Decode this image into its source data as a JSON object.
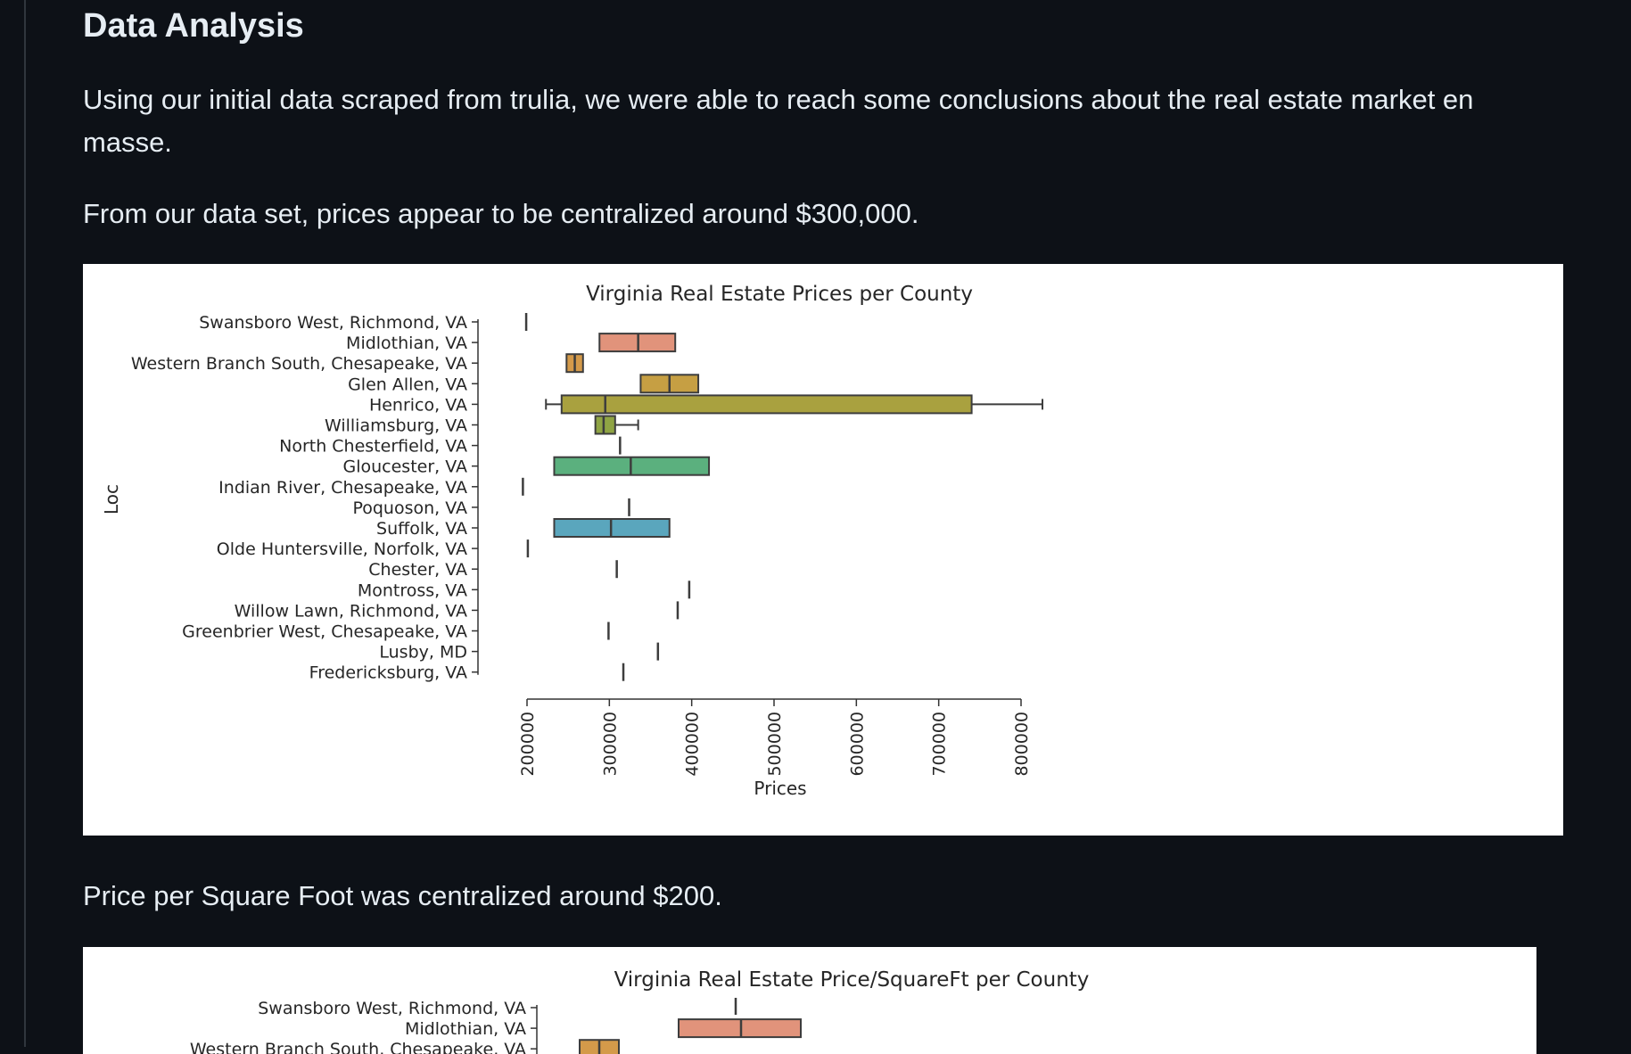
{
  "heading": "Data Analysis",
  "paragraphs": {
    "intro": "Using our initial data scraped from trulia, we were able to reach some conclusions about the real estate market en masse.",
    "prices": "From our data set, prices appear to be centralized around $300,000.",
    "ppsf": "Price per Square Foot was centralized around $200."
  },
  "chart_data": [
    {
      "type": "boxplot",
      "orientation": "horizontal",
      "title": "Virginia Real Estate Prices per County",
      "xlabel": "Prices",
      "ylabel": "Loc",
      "xlim": [
        200000,
        800000
      ],
      "xticks": [
        200000,
        300000,
        400000,
        500000,
        600000,
        700000,
        800000
      ],
      "tick_label_rotation": 90,
      "categories": [
        {
          "label": "Swansboro West, Richmond, VA",
          "color": "#cccccc",
          "whislo": 199000,
          "q1": 199000,
          "med": 199000,
          "q3": 199000,
          "whishi": 199000
        },
        {
          "label": "Midlothian, VA",
          "color": "#e1937b",
          "whislo": 288000,
          "q1": 288000,
          "med": 335000,
          "q3": 380000,
          "whishi": 380000
        },
        {
          "label": "Western Branch South, Chesapeake, VA",
          "color": "#d49a4a",
          "whislo": 248000,
          "q1": 248000,
          "med": 258000,
          "q3": 268000,
          "whishi": 268000
        },
        {
          "label": "Glen Allen, VA",
          "color": "#c69f43",
          "whislo": 338000,
          "q1": 338000,
          "med": 373000,
          "q3": 408000,
          "whishi": 408000
        },
        {
          "label": "Henrico, VA",
          "color": "#a9a13f",
          "whislo": 223000,
          "q1": 242000,
          "med": 295000,
          "q3": 740000,
          "whishi": 826000
        },
        {
          "label": "Williamsburg, VA",
          "color": "#8fa444",
          "whislo": 283000,
          "q1": 283000,
          "med": 293000,
          "q3": 307000,
          "whishi": 335000
        },
        {
          "label": "North Chesterfield, VA",
          "color": "#6aa65a",
          "whislo": 313000,
          "q1": 313000,
          "med": 313000,
          "q3": 313000,
          "whishi": 313000
        },
        {
          "label": "Gloucester, VA",
          "color": "#5bb07e",
          "whislo": 233000,
          "q1": 233000,
          "med": 326000,
          "q3": 421000,
          "whishi": 421000
        },
        {
          "label": "Indian River, Chesapeake, VA",
          "color": "#5aac95",
          "whislo": 195000,
          "q1": 195000,
          "med": 195000,
          "q3": 195000,
          "whishi": 195000
        },
        {
          "label": "Poquoson, VA",
          "color": "#5aa8a6",
          "whislo": 324000,
          "q1": 324000,
          "med": 324000,
          "q3": 324000,
          "whishi": 324000
        },
        {
          "label": "Suffolk, VA",
          "color": "#5aa6bd",
          "whislo": 233000,
          "q1": 233000,
          "med": 302000,
          "q3": 373000,
          "whishi": 373000
        },
        {
          "label": "Olde Huntersville, Norfolk, VA",
          "color": "#6a9fd0",
          "whislo": 201000,
          "q1": 201000,
          "med": 201000,
          "q3": 201000,
          "whishi": 201000
        },
        {
          "label": "Chester, VA",
          "color": "#8f95d8",
          "whislo": 309000,
          "q1": 309000,
          "med": 309000,
          "q3": 309000,
          "whishi": 309000
        },
        {
          "label": "Montross, VA",
          "color": "#ad8cd6",
          "whislo": 397000,
          "q1": 397000,
          "med": 397000,
          "q3": 397000,
          "whishi": 397000
        },
        {
          "label": "Willow Lawn, Richmond, VA",
          "color": "#c885cf",
          "whislo": 383000,
          "q1": 383000,
          "med": 383000,
          "q3": 383000,
          "whishi": 383000
        },
        {
          "label": "Greenbrier West, Chesapeake, VA",
          "color": "#d98bc0",
          "whislo": 299000,
          "q1": 299000,
          "med": 299000,
          "q3": 299000,
          "whishi": 299000
        },
        {
          "label": "Lusby, MD",
          "color": "#e08fab",
          "whislo": 359000,
          "q1": 359000,
          "med": 359000,
          "q3": 359000,
          "whishi": 359000
        },
        {
          "label": "Fredericksburg, VA",
          "color": "#e39598",
          "whislo": 317000,
          "q1": 317000,
          "med": 317000,
          "q3": 317000,
          "whishi": 317000
        }
      ]
    },
    {
      "type": "boxplot",
      "orientation": "horizontal",
      "title": "Virginia Real Estate Price/SquareFt per County",
      "partially_visible": true,
      "categories": [
        {
          "label": "Swansboro West, Richmond, VA",
          "color": "#cccccc"
        },
        {
          "label": "Midlothian, VA",
          "color": "#e1937b"
        },
        {
          "label": "Western Branch South, Chesapeake, VA",
          "color": "#d49a4a"
        }
      ]
    }
  ]
}
